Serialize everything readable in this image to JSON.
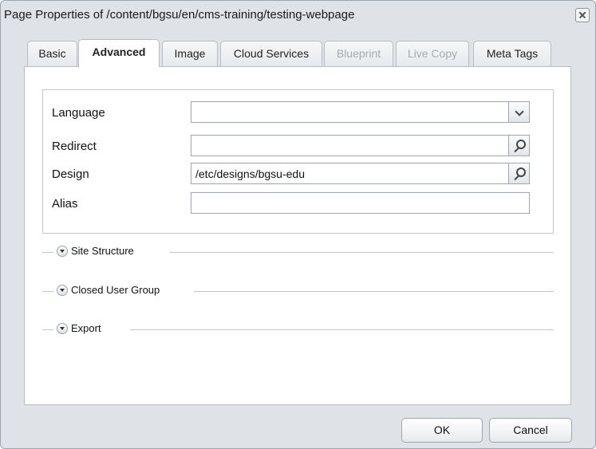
{
  "dialog": {
    "title": "Page Properties of /content/bgsu/en/cms-training/testing-webpage"
  },
  "tabs": [
    {
      "label": "Basic",
      "state": "normal"
    },
    {
      "label": "Advanced",
      "state": "active"
    },
    {
      "label": "Image",
      "state": "normal"
    },
    {
      "label": "Cloud Services",
      "state": "normal"
    },
    {
      "label": "Blueprint",
      "state": "disabled"
    },
    {
      "label": "Live Copy",
      "state": "disabled"
    },
    {
      "label": "Meta Tags",
      "state": "normal"
    }
  ],
  "form": {
    "language": {
      "label": "Language",
      "value": "",
      "icon": "chevron-down-icon"
    },
    "redirect": {
      "label": "Redirect",
      "value": "",
      "icon": "search-icon"
    },
    "design": {
      "label": "Design",
      "value": "/etc/designs/bgsu-edu",
      "icon": "search-icon"
    },
    "alias": {
      "label": "Alias",
      "value": ""
    }
  },
  "sections": [
    {
      "label": "Site Structure",
      "state": "collapsed"
    },
    {
      "label": "Closed User Group",
      "state": "collapsed"
    },
    {
      "label": "Export",
      "state": "collapsed"
    }
  ],
  "footer": {
    "ok_label": "OK",
    "cancel_label": "Cancel"
  }
}
